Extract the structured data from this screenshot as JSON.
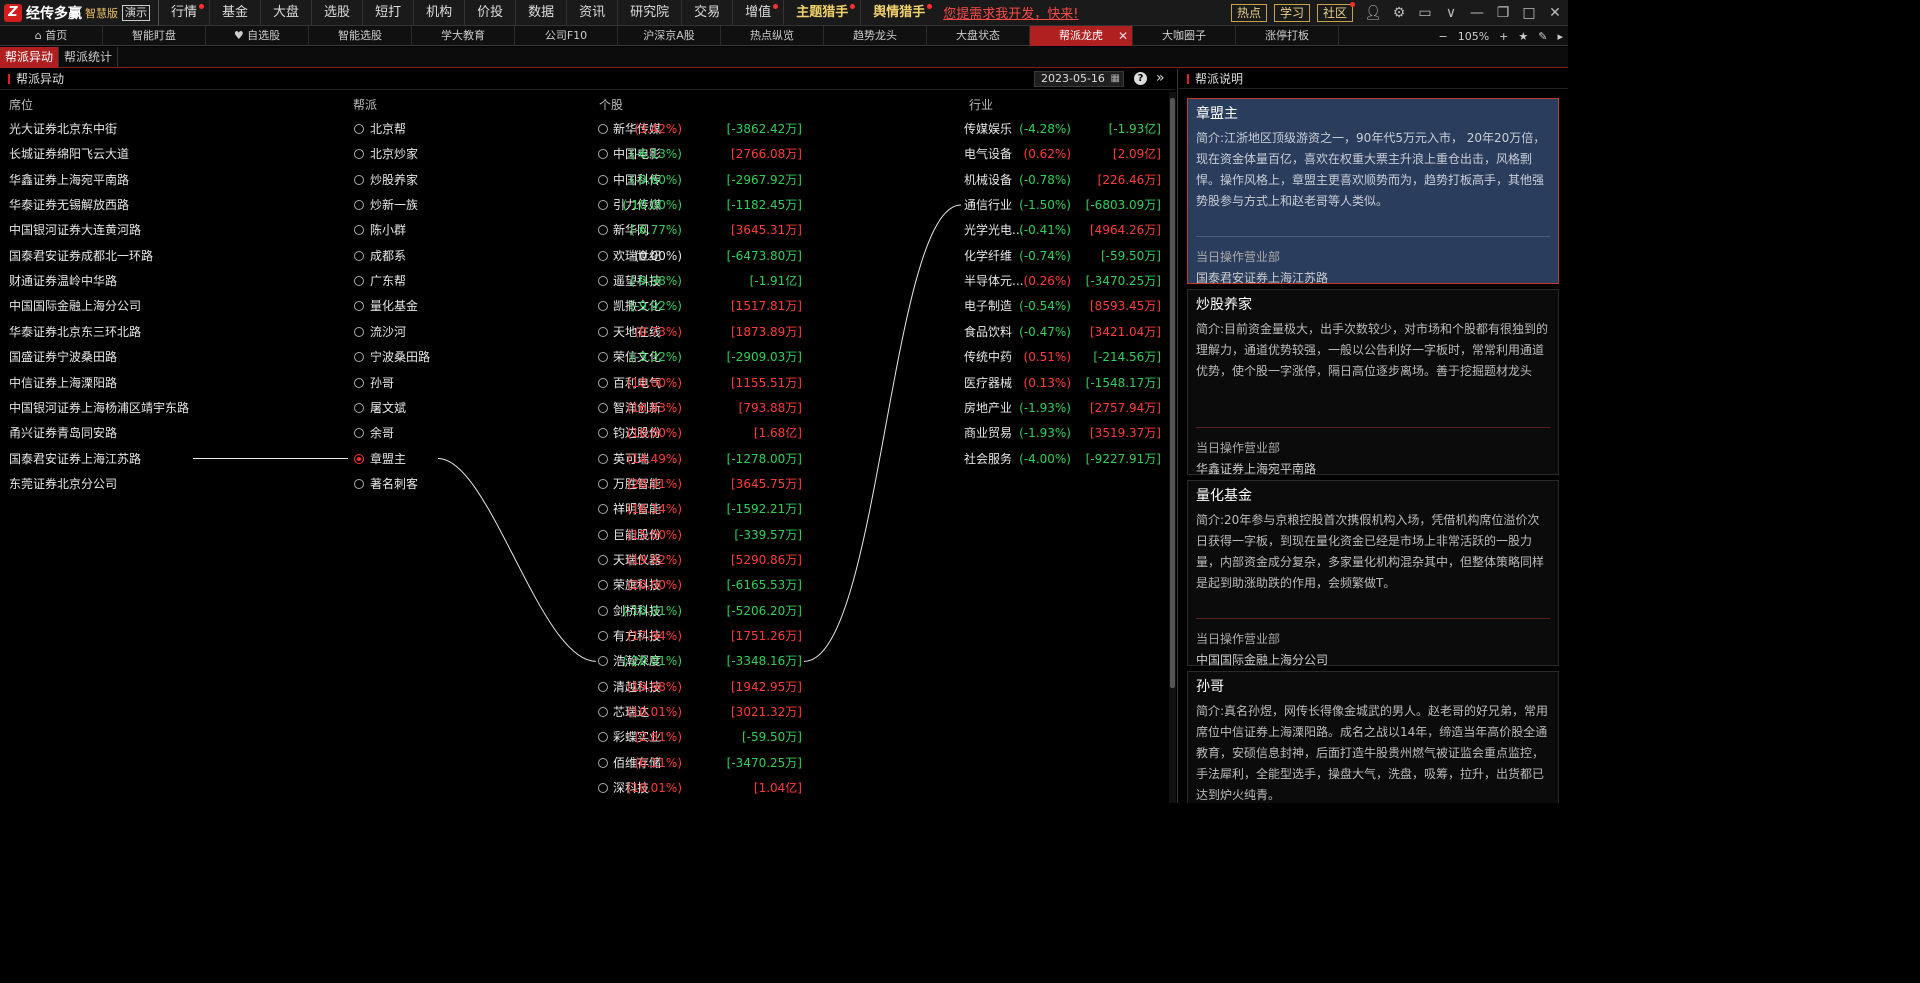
{
  "app": {
    "logo_mark": "Z",
    "name": "经传多赢",
    "edition": "智慧版",
    "demo": "演示",
    "promo": "您提需求我开发，快来!"
  },
  "menu": [
    {
      "label": "行情",
      "dot": true
    },
    {
      "label": "基金",
      "dot": false
    },
    {
      "label": "大盘",
      "dot": false
    },
    {
      "label": "选股",
      "dot": false
    },
    {
      "label": "短打",
      "dot": false
    },
    {
      "label": "机构",
      "dot": false
    },
    {
      "label": "价投",
      "dot": false
    },
    {
      "label": "数据",
      "dot": false
    },
    {
      "label": "资讯",
      "dot": false
    },
    {
      "label": "研究院",
      "dot": false
    },
    {
      "label": "交易",
      "dot": false
    },
    {
      "label": "增值",
      "dot": true
    },
    {
      "label": "主题猎手",
      "dot": true,
      "gold": true
    },
    {
      "label": "舆情猎手",
      "dot": true,
      "gold": true
    }
  ],
  "quick_buttons": [
    {
      "label": "热点",
      "dot": false
    },
    {
      "label": "学习",
      "dot": false
    },
    {
      "label": "社区",
      "dot": true
    }
  ],
  "window_icons": [
    "user-icon",
    "settings-icon",
    "layout-icon",
    "chevron-down-icon",
    "minimize-icon",
    "restore-icon",
    "maximize-icon",
    "close-icon"
  ],
  "tabs": [
    {
      "label": "⌂ 首页"
    },
    {
      "label": "智能盯盘"
    },
    {
      "label": "♥ 自选股"
    },
    {
      "label": "智能选股"
    },
    {
      "label": "学大教育"
    },
    {
      "label": "公司F10"
    },
    {
      "label": "沪深京A股"
    },
    {
      "label": "热点纵览"
    },
    {
      "label": "趋势龙头"
    },
    {
      "label": "大盘状态"
    },
    {
      "label": "帮派龙虎",
      "active": true
    },
    {
      "label": "大咖圈子"
    },
    {
      "label": "涨停打板"
    }
  ],
  "zoom": {
    "minus": "−",
    "value": "105%",
    "plus": "+"
  },
  "subtabs": [
    {
      "label": "帮派异动",
      "active": true
    },
    {
      "label": "帮派统计"
    }
  ],
  "left_panel": {
    "title": "帮派异动",
    "date": "2023-05-16",
    "columns": {
      "seat": "席位",
      "gang": "帮派",
      "stock": "个股",
      "industry": "行业"
    }
  },
  "seats": [
    "光大证券北京东中街",
    "长城证券绵阳飞云大道",
    "华鑫证券上海宛平南路",
    "华泰证券无锡解放西路",
    "中国银河证券大连黄河路",
    "国泰君安证券成都北一环路",
    "财通证券温岭中华路",
    "中国国际金融上海分公司",
    "华泰证券北京东三环北路",
    "国盛证券宁波桑田路",
    "中信证券上海溧阳路",
    "中国银河证券上海杨浦区靖宇东路",
    "甬兴证券青岛同安路",
    "国泰君安证券上海江苏路",
    "东莞证券北京分公司"
  ],
  "gangs": [
    {
      "name": "北京帮",
      "checked": false
    },
    {
      "name": "北京炒家",
      "checked": false
    },
    {
      "name": "炒股养家",
      "checked": false
    },
    {
      "name": "炒新一族",
      "checked": false
    },
    {
      "name": "陈小群",
      "checked": false
    },
    {
      "name": "成都系",
      "checked": false
    },
    {
      "name": "广东帮",
      "checked": false
    },
    {
      "name": "量化基金",
      "checked": false
    },
    {
      "name": "流沙河",
      "checked": false
    },
    {
      "name": "宁波桑田路",
      "checked": false
    },
    {
      "name": "孙哥",
      "checked": false
    },
    {
      "name": "屠文斌",
      "checked": false
    },
    {
      "name": "余哥",
      "checked": false
    },
    {
      "name": "章盟主",
      "checked": true
    },
    {
      "name": "著名刺客",
      "checked": false
    }
  ],
  "stocks": [
    {
      "name": "新华传媒",
      "pct": "(3.42%)",
      "amt": "[-3862.42万]",
      "pct_dir": "up",
      "amt_dir": "down"
    },
    {
      "name": "中国电影",
      "pct": "(-6.13%)",
      "amt": "[2766.08万]",
      "pct_dir": "down",
      "amt_dir": "up"
    },
    {
      "name": "中国科传",
      "pct": "(-9.60%)",
      "amt": "[-2967.92万]",
      "pct_dir": "down",
      "amt_dir": "down"
    },
    {
      "name": "引力传媒",
      "pct": "(-10.00%)",
      "amt": "[-1182.45万]",
      "pct_dir": "down",
      "amt_dir": "down"
    },
    {
      "name": "新华网",
      "pct": "(-6.77%)",
      "amt": "[3645.31万]",
      "pct_dir": "down",
      "amt_dir": "up"
    },
    {
      "name": "欢瑞世纪",
      "pct": "(0.00%)",
      "amt": "[-6473.80万]",
      "pct_dir": "flat",
      "amt_dir": "down"
    },
    {
      "name": "遥望科技",
      "pct": "(-9.98%)",
      "amt": "[-1.91亿]",
      "pct_dir": "down",
      "amt_dir": "down"
    },
    {
      "name": "凯撒文化",
      "pct": "(-9.92%)",
      "amt": "[1517.81万]",
      "pct_dir": "down",
      "amt_dir": "up"
    },
    {
      "name": "天地在线",
      "pct": "(0.73%)",
      "amt": "[1873.89万]",
      "pct_dir": "up",
      "amt_dir": "up"
    },
    {
      "name": "荣信文化",
      "pct": "(-3.32%)",
      "amt": "[-2909.03万]",
      "pct_dir": "down",
      "amt_dir": "down"
    },
    {
      "name": "百利电气",
      "pct": "(10.00%)",
      "amt": "[1155.51万]",
      "pct_dir": "up",
      "amt_dir": "up"
    },
    {
      "name": "智洋创新",
      "pct": "(16.83%)",
      "amt": "[793.88万]",
      "pct_dir": "up",
      "amt_dir": "up"
    },
    {
      "name": "钧达股份",
      "pct": "(10.00%)",
      "amt": "[1.68亿]",
      "pct_dir": "up",
      "amt_dir": "up"
    },
    {
      "name": "英可瑞",
      "pct": "(14.49%)",
      "amt": "[-1278.00万]",
      "pct_dir": "up",
      "amt_dir": "down"
    },
    {
      "name": "万胜智能",
      "pct": "(20.01%)",
      "amt": "[3645.75万]",
      "pct_dir": "up",
      "amt_dir": "up"
    },
    {
      "name": "祥明智能",
      "pct": "(16.14%)",
      "amt": "[-1592.21万]",
      "pct_dir": "up",
      "amt_dir": "down"
    },
    {
      "name": "巨能股份",
      "pct": "(15.00%)",
      "amt": "[-339.57万]",
      "pct_dir": "up",
      "amt_dir": "down"
    },
    {
      "name": "天瑞仪器",
      "pct": "(19.92%)",
      "amt": "[5290.86万]",
      "pct_dir": "up",
      "amt_dir": "up"
    },
    {
      "name": "荣旗科技",
      "pct": "(20.00%)",
      "amt": "[-6165.53万]",
      "pct_dir": "up",
      "amt_dir": "down"
    },
    {
      "name": "剑桥科技",
      "pct": "(-10.01%)",
      "amt": "[-5206.20万]",
      "pct_dir": "down",
      "amt_dir": "down"
    },
    {
      "name": "有方科技",
      "pct": "(17.94%)",
      "amt": "[1751.26万]",
      "pct_dir": "up",
      "amt_dir": "up"
    },
    {
      "name": "浩瀚深度",
      "pct": "(-20.01%)",
      "amt": "[-3348.16万]",
      "pct_dir": "down",
      "amt_dir": "down"
    },
    {
      "name": "清越科技",
      "pct": "(19.98%)",
      "amt": "[1942.95万]",
      "pct_dir": "up",
      "amt_dir": "up"
    },
    {
      "name": "芯瑞达",
      "pct": "(10.01%)",
      "amt": "[3021.32万]",
      "pct_dir": "up",
      "amt_dir": "up"
    },
    {
      "name": "彩蝶实业",
      "pct": "(2.81%)",
      "amt": "[-59.50万]",
      "pct_dir": "up",
      "amt_dir": "down"
    },
    {
      "name": "佰维存储",
      "pct": "(6.11%)",
      "amt": "[-3470.25万]",
      "pct_dir": "up",
      "amt_dir": "down"
    },
    {
      "name": "深科技",
      "pct": "(10.01%)",
      "amt": "[1.04亿]",
      "pct_dir": "up",
      "amt_dir": "up"
    }
  ],
  "industries": [
    {
      "name": "传媒娱乐",
      "pct": "(-4.28%)",
      "amt": "[-1.93亿]",
      "pct_dir": "down",
      "amt_dir": "down"
    },
    {
      "name": "电气设备",
      "pct": "(0.62%)",
      "amt": "[2.09亿]",
      "pct_dir": "up",
      "amt_dir": "up"
    },
    {
      "name": "机械设备",
      "pct": "(-0.78%)",
      "amt": "[226.46万]",
      "pct_dir": "down",
      "amt_dir": "up"
    },
    {
      "name": "通信行业",
      "pct": "(-1.50%)",
      "amt": "[-6803.09万]",
      "pct_dir": "down",
      "amt_dir": "down"
    },
    {
      "name": "光学光电...",
      "pct": "(-0.41%)",
      "amt": "[4964.26万]",
      "pct_dir": "down",
      "amt_dir": "up"
    },
    {
      "name": "化学纤维",
      "pct": "(-0.74%)",
      "amt": "[-59.50万]",
      "pct_dir": "down",
      "amt_dir": "down"
    },
    {
      "name": "半导体元...",
      "pct": "(0.26%)",
      "amt": "[-3470.25万]",
      "pct_dir": "up",
      "amt_dir": "down"
    },
    {
      "name": "电子制造",
      "pct": "(-0.54%)",
      "amt": "[8593.45万]",
      "pct_dir": "down",
      "amt_dir": "up"
    },
    {
      "name": "食品饮料",
      "pct": "(-0.47%)",
      "amt": "[3421.04万]",
      "pct_dir": "down",
      "amt_dir": "up"
    },
    {
      "name": "传统中药",
      "pct": "(0.51%)",
      "amt": "[-214.56万]",
      "pct_dir": "up",
      "amt_dir": "down"
    },
    {
      "name": "医疗器械",
      "pct": "(0.13%)",
      "amt": "[-1548.17万]",
      "pct_dir": "up",
      "amt_dir": "down"
    },
    {
      "name": "房地产业",
      "pct": "(-1.93%)",
      "amt": "[2757.94万]",
      "pct_dir": "down",
      "amt_dir": "up"
    },
    {
      "name": "商业贸易",
      "pct": "(-1.93%)",
      "amt": "[3519.37万]",
      "pct_dir": "down",
      "amt_dir": "up"
    },
    {
      "name": "社会服务",
      "pct": "(-4.00%)",
      "amt": "[-9227.91万]",
      "pct_dir": "down",
      "amt_dir": "down"
    }
  ],
  "selection": {
    "seat_index": 13,
    "gang_index": 13,
    "stock_index": 21,
    "industry_index": 3
  },
  "right_panel": {
    "title": "帮派说明",
    "branch_label": "当日操作营业部",
    "cards": [
      {
        "title": "章盟主",
        "desc": "简介:江浙地区顶级游资之一，90年代5万元入市， 20年20万倍，现在资金体量百亿，喜欢在权重大票主升浪上重仓出击，风格剽悍。操作风格上，章盟主更喜欢顺势而为，趋势打板高手，其他强势股参与方式上和赵老哥等人类似。",
        "branch": "国泰君安证券上海江苏路",
        "active": true
      },
      {
        "title": "炒股养家",
        "desc": "简介:目前资金量极大，出手次数较少，对市场和个股都有很独到的理解力，通道优势较强，一般以公告利好一字板时，常常利用通道优势，使个股一字涨停，隔日高位逐步离场。善于挖掘题材龙头",
        "branch": "华鑫证券上海宛平南路",
        "active": false
      },
      {
        "title": "量化基金",
        "desc": "简介:20年参与京粮控股首次携假机构入场，凭借机构席位溢价次日获得一字板，到现在量化资金已经是市场上非常活跃的一股力量，内部资金成分复杂，多家量化机构混杂其中，但整体策略同样是起到助涨助跌的作用，会频繁做T。",
        "branch": "中国国际金融上海分公司",
        "active": false
      },
      {
        "title": "孙哥",
        "desc": "简介:真名孙煜，网传长得像金城武的男人。赵老哥的好兄弟，常用席位中信证券上海溧阳路。成名之战以14年，缔造当年高价股全通教育，安硕信息封神，后面打造牛股贵州燃气被证监会重点监控，手法犀利，全能型选手，操盘大气，洗盘，吸筹，拉升，出货都已达到炉火纯青。",
        "branch": "",
        "active": false
      }
    ]
  }
}
